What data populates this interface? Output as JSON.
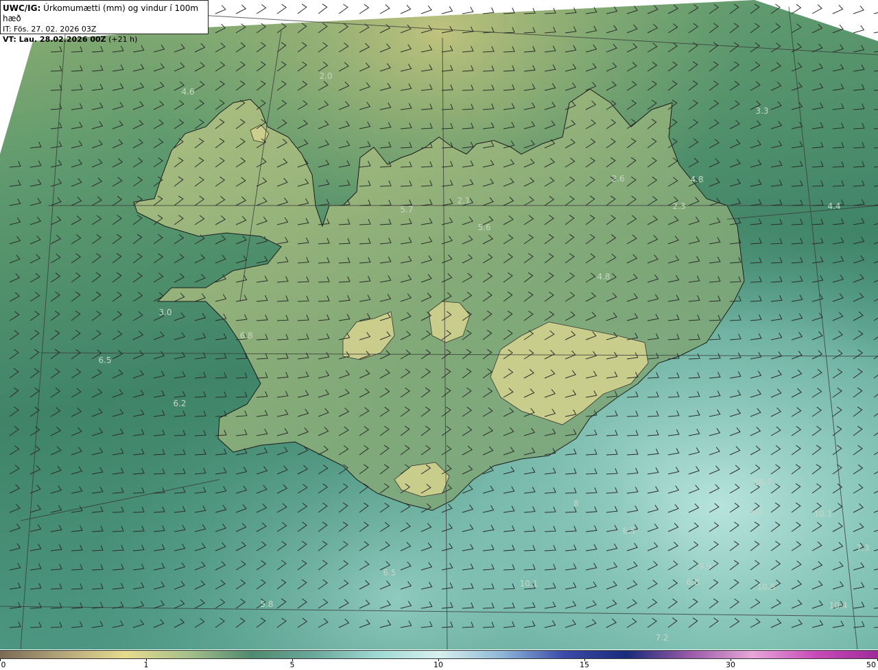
{
  "header": {
    "title_bold": "UWC/IG:",
    "title_rest": " Úrkomumætti (mm) og vindur í 100m hæð",
    "issue_time": "IT: Fös. 27. 02. 2026 03Z",
    "valid_bold": "VT: Lau. 28.02.2026 00Z",
    "valid_rest": " (+21 h)"
  },
  "colorbar": {
    "ticks": [
      "0",
      "1",
      "5",
      "10",
      "15",
      "30",
      "50"
    ],
    "stops": [
      "#7a6a54",
      "#b5a67a",
      "#e6dc8e",
      "#a7c08a",
      "#4f8a70",
      "#6aa89a",
      "#9fd8d3",
      "#d8f0ee",
      "#8fb8d8",
      "#3a4aa8",
      "#1a2a7a",
      "#9a5aa8",
      "#e6a6d8",
      "#c84ab8",
      "#a02a9a"
    ]
  },
  "values": [
    "4.6",
    "2.0",
    "3.3",
    "5.7",
    "2.1",
    "5.6",
    "2.6",
    "4.8",
    "2.3",
    "4.4",
    "4.8",
    "3.0",
    "6.8",
    "6.5",
    "6.2",
    "10.7",
    "6.4",
    "10.1",
    "6.5",
    "8",
    "7.3",
    "6.5",
    "9.9",
    "10.1",
    "6.8",
    "10.5",
    "5.8",
    "10.4",
    "7.2"
  ],
  "colors": {
    "land_light": "#cfd18b",
    "sea": "#3d8468",
    "southeast_sea": "#9fd5cc"
  }
}
